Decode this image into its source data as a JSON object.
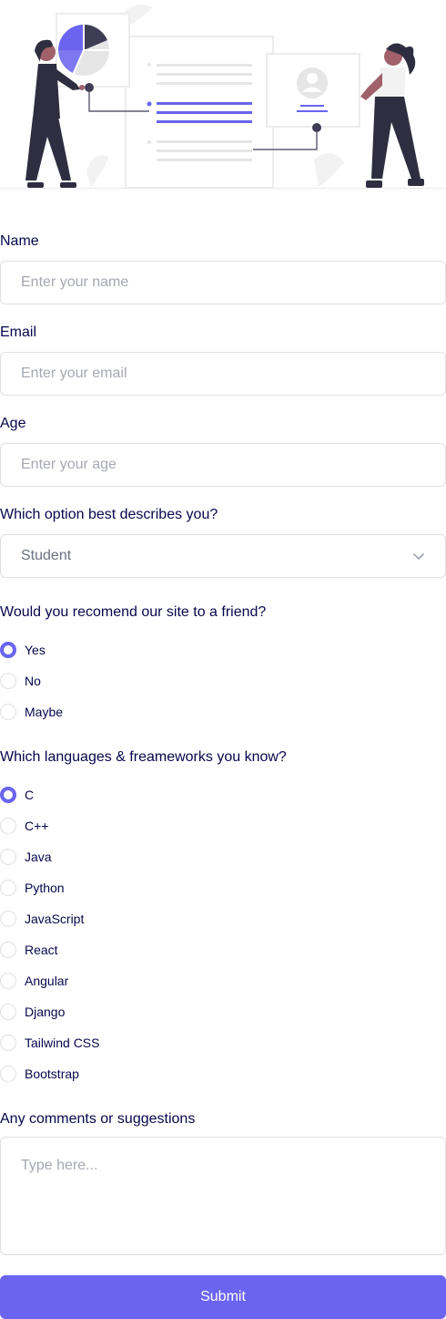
{
  "colors": {
    "accent": "#6A64F1",
    "text": "#07074D",
    "border": "#e0e0e0",
    "placeholder": "#a6a8b3"
  },
  "form": {
    "name": {
      "label": "Name",
      "placeholder": "Enter your name"
    },
    "email": {
      "label": "Email",
      "placeholder": "Enter your email"
    },
    "age": {
      "label": "Age",
      "placeholder": "Enter your age"
    },
    "role": {
      "label": "Which option best describes you?",
      "selected": "Student",
      "icon": "chevron-down-icon"
    },
    "recommend": {
      "label": "Would you recomend our site to a friend?",
      "options": [
        "Yes",
        "No",
        "Maybe"
      ],
      "selected_index": 0
    },
    "languages": {
      "label": "Which languages & freameworks you know?",
      "options": [
        "C",
        "C++",
        "Java",
        "Python",
        "JavaScript",
        "React",
        "Angular",
        "Django",
        "Tailwind CSS",
        "Bootstrap"
      ],
      "selected_index": 0
    },
    "comments": {
      "label": "Any comments or suggestions",
      "placeholder": "Type here..."
    },
    "submit_label": "Submit"
  }
}
